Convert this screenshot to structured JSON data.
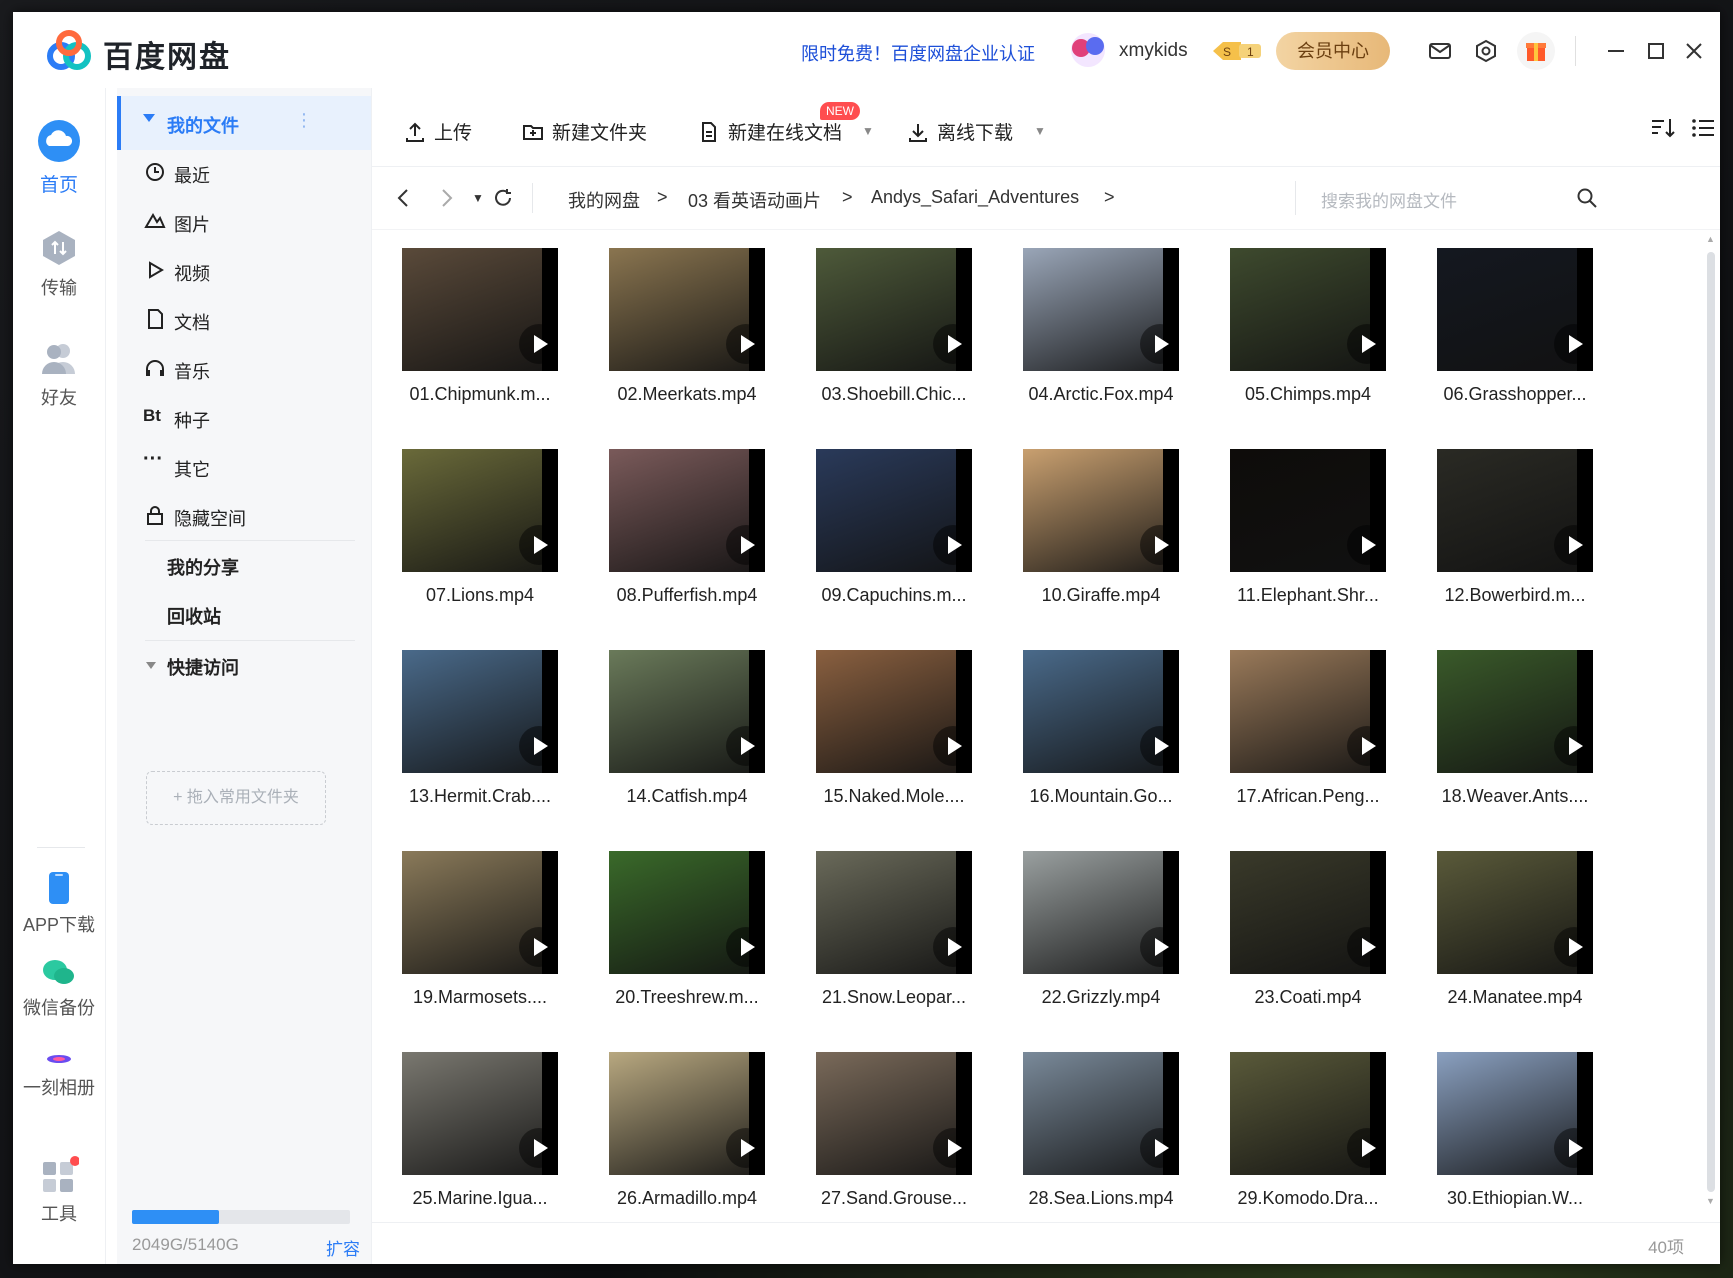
{
  "app": {
    "title": "百度网盘"
  },
  "header": {
    "promo": "限时免费！百度网盘企业认证",
    "username": "xmykids",
    "vip_button": "会员中心"
  },
  "leftnav": [
    {
      "label": "首页",
      "icon": "cloud-icon",
      "active": true
    },
    {
      "label": "传输",
      "icon": "transfer-icon"
    },
    {
      "label": "好友",
      "icon": "friends-icon"
    },
    {
      "label": "APP下载",
      "icon": "phone-icon"
    },
    {
      "label": "微信备份",
      "icon": "wechat-icon"
    },
    {
      "label": "一刻相册",
      "icon": "album-icon"
    },
    {
      "label": "工具",
      "icon": "tools-icon"
    }
  ],
  "sidebar": {
    "my_files": "我的文件",
    "items": [
      {
        "label": "最近",
        "icon": "clock-icon"
      },
      {
        "label": "图片",
        "icon": "image-icon"
      },
      {
        "label": "视频",
        "icon": "video-icon"
      },
      {
        "label": "文档",
        "icon": "document-icon"
      },
      {
        "label": "音乐",
        "icon": "headphones-icon"
      },
      {
        "label": "种子",
        "icon": "bt-icon"
      },
      {
        "label": "其它",
        "icon": "more-icon"
      },
      {
        "label": "隐藏空间",
        "icon": "lock-icon"
      }
    ],
    "my_share": "我的分享",
    "recycle": "回收站",
    "quick_access": "快捷访问",
    "quick_drop": "+ 拖入常用文件夹",
    "storage_text": "2049G/5140G",
    "storage_fraction": 0.399,
    "expand": "扩容"
  },
  "toolbar": {
    "upload": "上传",
    "new_folder": "新建文件夹",
    "new_online_doc": "新建在线文档",
    "new_tag": "NEW",
    "offline_download": "离线下载"
  },
  "breadcrumb": {
    "root": "我的网盘",
    "level1": "03 看英语动画片",
    "level2": "Andys_Safari_Adventures",
    "sep": ">"
  },
  "search": {
    "placeholder": "搜索我的网盘文件"
  },
  "files": [
    "01.Chipmunk.m...",
    "02.Meerkats.mp4",
    "03.Shoebill.Chic...",
    "04.Arctic.Fox.mp4",
    "05.Chimps.mp4",
    "06.Grasshopper...",
    "07.Lions.mp4",
    "08.Pufferfish.mp4",
    "09.Capuchins.m...",
    "10.Giraffe.mp4",
    "11.Elephant.Shr...",
    "12.Bowerbird.m...",
    "13.Hermit.Crab....",
    "14.Catfish.mp4",
    "15.Naked.Mole....",
    "16.Mountain.Go...",
    "17.African.Peng...",
    "18.Weaver.Ants....",
    "19.Marmosets....",
    "20.Treeshrew.m...",
    "21.Snow.Leopar...",
    "22.Grizzly.mp4",
    "23.Coati.mp4",
    "24.Manatee.mp4",
    "25.Marine.Igua...",
    "26.Armadillo.mp4",
    "27.Sand.Grouse...",
    "28.Sea.Lions.mp4",
    "29.Komodo.Dra...",
    "30.Ethiopian.W..."
  ],
  "thumb_colors": [
    "#5a4a3a",
    "#8a7550",
    "#4e5a3a",
    "#9aa6b8",
    "#3e4a2e",
    "#141820",
    "#6a6a3a",
    "#7a5a5a",
    "#2a3a5a",
    "#c9a070",
    "#0e0c0a",
    "#2a2a24",
    "#4a6a8a",
    "#6a7a5a",
    "#8a6040",
    "#4a6a8a",
    "#9a7a5a",
    "#3a5a2a",
    "#8a7a5a",
    "#3a6a2a",
    "#6a6a5a",
    "#9aa0a0",
    "#3a3a2a",
    "#5a5a3a",
    "#7a7870",
    "#b8a880",
    "#7a6a5a",
    "#7a8a9a",
    "#5a5a3a",
    "#8aa0c0"
  ],
  "footer": {
    "count": "40项"
  },
  "colors": {
    "accent": "#2b7cf6",
    "active_bg": "#e8f1fd"
  }
}
